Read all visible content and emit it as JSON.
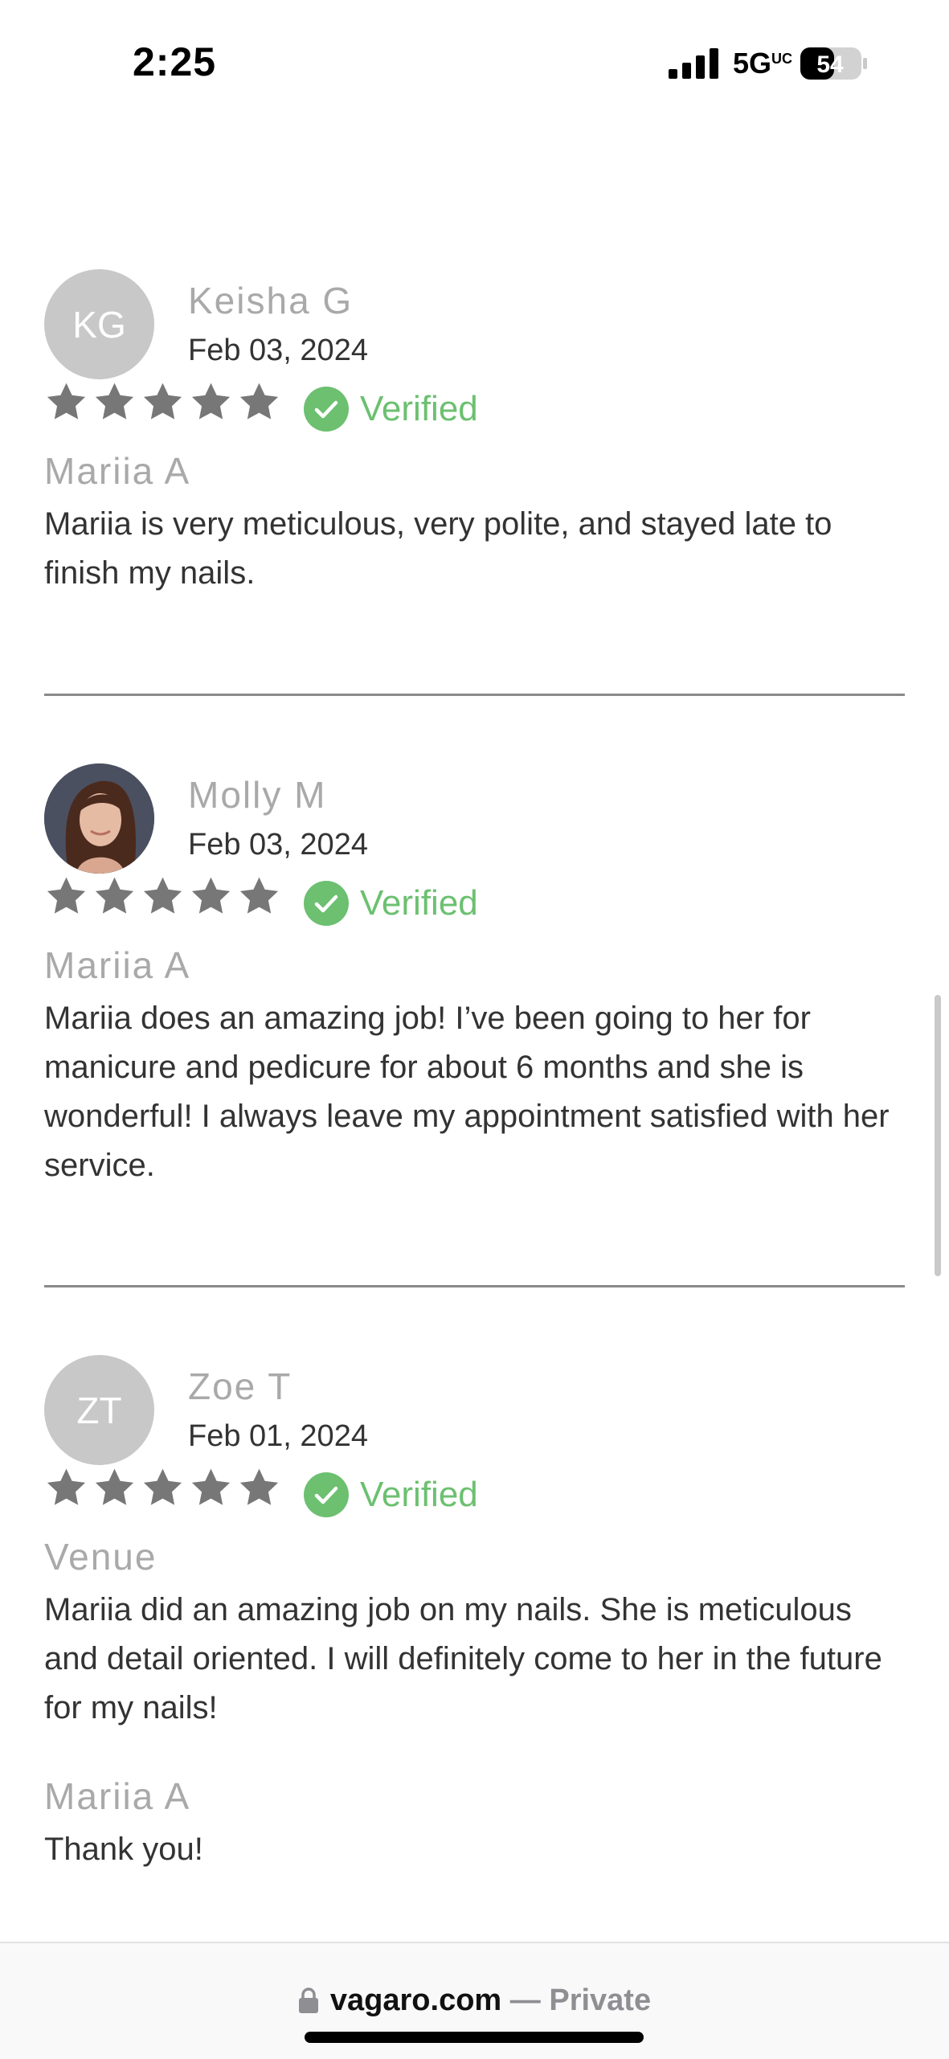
{
  "status_bar": {
    "time": "2:25",
    "network": "5G",
    "network_suffix": "UC",
    "battery": "54"
  },
  "colors": {
    "star": "#777777",
    "verified": "#6cc070",
    "avatar_bg": "#c8c8c8"
  },
  "reviews": [
    {
      "initials": "KG",
      "avatar_type": "initials",
      "name": "Keisha G",
      "date": "Feb 03, 2024",
      "rating": 5,
      "verified_label": "Verified",
      "staff": "Mariia A",
      "text": "Mariia is very meticulous, very polite, and stayed late to finish my nails."
    },
    {
      "initials": "",
      "avatar_type": "photo",
      "name": "Molly M",
      "date": "Feb 03, 2024",
      "rating": 5,
      "verified_label": "Verified",
      "staff": "Mariia A",
      "text": "Mariia does an amazing job! I’ve been going to her for manicure and pedicure for about 6 months and she is wonderful! I always leave my appointment satisfied with her service."
    },
    {
      "initials": "ZT",
      "avatar_type": "initials",
      "name": "Zoe T",
      "date": "Feb 01, 2024",
      "rating": 5,
      "verified_label": "Verified",
      "staff": "Venue",
      "text": "Mariia did an amazing job on my nails. She is meticulous and detail oriented. I will definitely come to her in the future for my nails!",
      "reply_author": "Mariia A",
      "reply_text": "Thank you!"
    }
  ],
  "browser": {
    "domain": "vagaro.com",
    "separator": " — ",
    "mode": "Private"
  }
}
